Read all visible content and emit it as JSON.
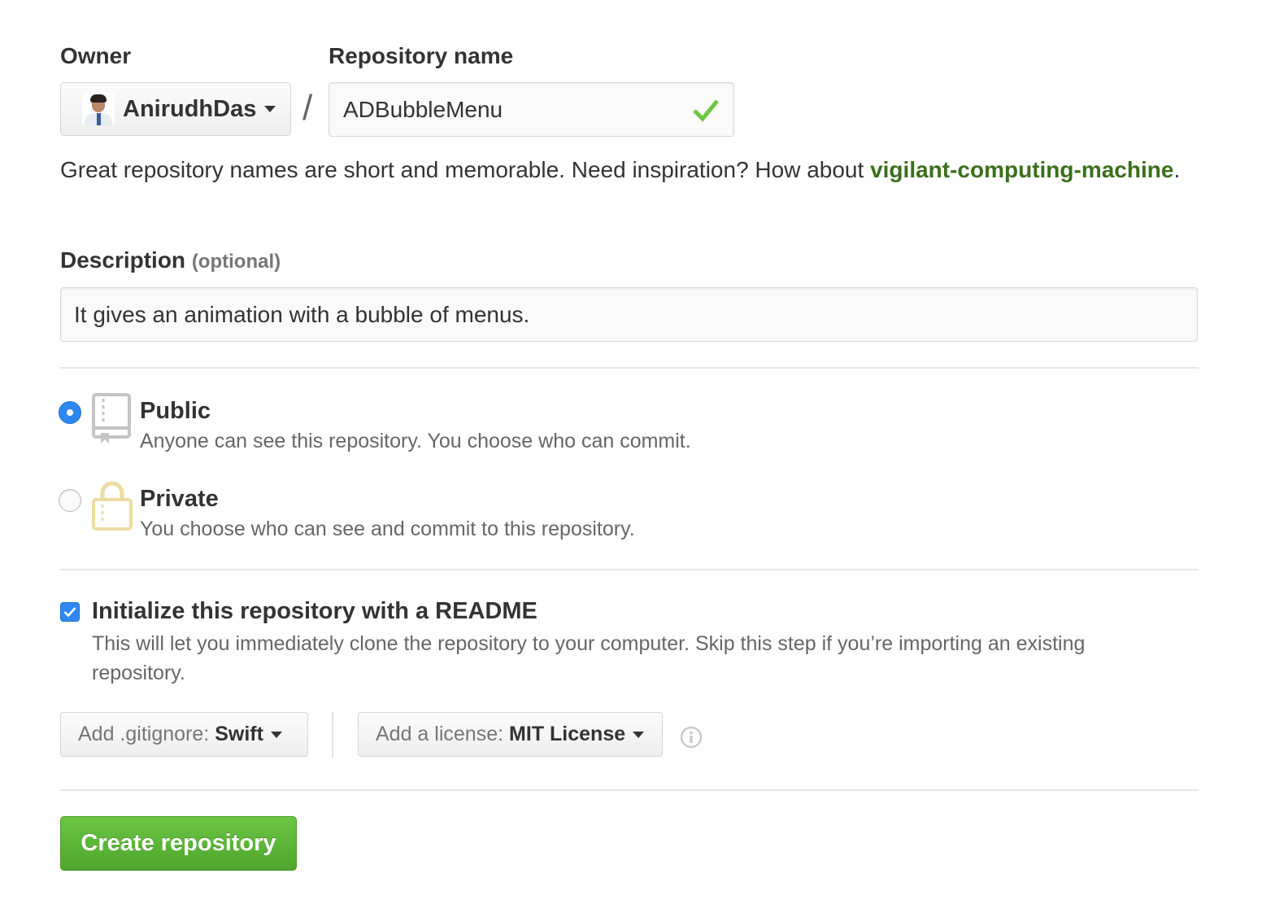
{
  "owner": {
    "label": "Owner",
    "name": "AnirudhDas"
  },
  "repository": {
    "label": "Repository name",
    "slash": "/",
    "value": "ADBubbleMenu",
    "valid_icon": "check-icon"
  },
  "hint": {
    "text": "Great repository names are short and memorable. Need inspiration? How about ",
    "suggestion": "vigilant-computing-machine",
    "end": "."
  },
  "description": {
    "label": "Description",
    "optional": "(optional)",
    "value": "It gives an animation with a bubble of menus."
  },
  "visibility": {
    "public": {
      "title": "Public",
      "desc": "Anyone can see this repository. You choose who can commit.",
      "selected": true,
      "icon": "repo-book-icon"
    },
    "private": {
      "title": "Private",
      "desc": "You choose who can see and commit to this repository.",
      "selected": false,
      "icon": "lock-icon"
    }
  },
  "readme": {
    "checked": true,
    "title": "Initialize this repository with a README",
    "desc": "This will let you immediately clone the repository to your computer. Skip this step if you’re importing an existing repository."
  },
  "gitignore": {
    "prefix": "Add .gitignore:",
    "value": "Swift"
  },
  "license": {
    "prefix": "Add a license:",
    "value": "MIT License"
  },
  "info_icon": "info-icon",
  "submit_label": "Create repository",
  "colors": {
    "accent_blue": "#2e88f0",
    "success_green": "#6cc644",
    "suggestion_green": "#3b6f1a",
    "lock_yellow": "#e8d594"
  }
}
